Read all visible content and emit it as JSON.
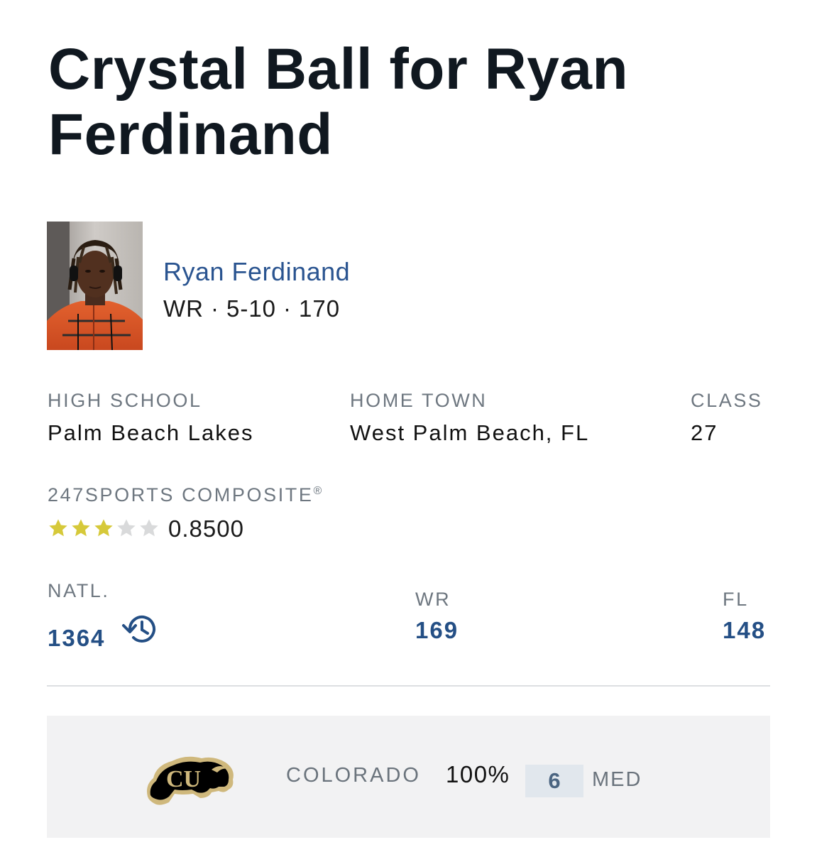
{
  "page": {
    "title": "Crystal Ball for Ryan Ferdinand"
  },
  "player": {
    "name": "Ryan Ferdinand",
    "position": "WR",
    "height": "5-10",
    "weight": "170",
    "separator": "·"
  },
  "details": {
    "high_school_label": "HIGH SCHOOL",
    "high_school": "Palm Beach Lakes",
    "home_town_label": "HOME TOWN",
    "home_town": "West Palm Beach, FL",
    "class_label": "CLASS",
    "class": "27"
  },
  "composite": {
    "label": "247SPORTS COMPOSITE",
    "registered_mark": "®",
    "stars_filled": 3,
    "stars_total": 5,
    "rating": "0.8500",
    "star_color": "#d6c93a",
    "star_empty_color": "#d9dadb"
  },
  "rankings": {
    "national_label": "NATL.",
    "national": "1364",
    "national_icon": "history-icon",
    "position_label": "WR",
    "position_rank": "169",
    "state_label": "FL",
    "state_rank": "148"
  },
  "prediction": {
    "logo_icon": "colorado-buffaloes-logo",
    "school": "COLORADO",
    "percent": "100%",
    "confidence": "6",
    "confidence_label": "MED"
  },
  "colors": {
    "link_blue": "#2a5490",
    "rank_blue": "#244f85",
    "label_gray": "#6e7780",
    "colorado_gold": "#cfb87c"
  }
}
